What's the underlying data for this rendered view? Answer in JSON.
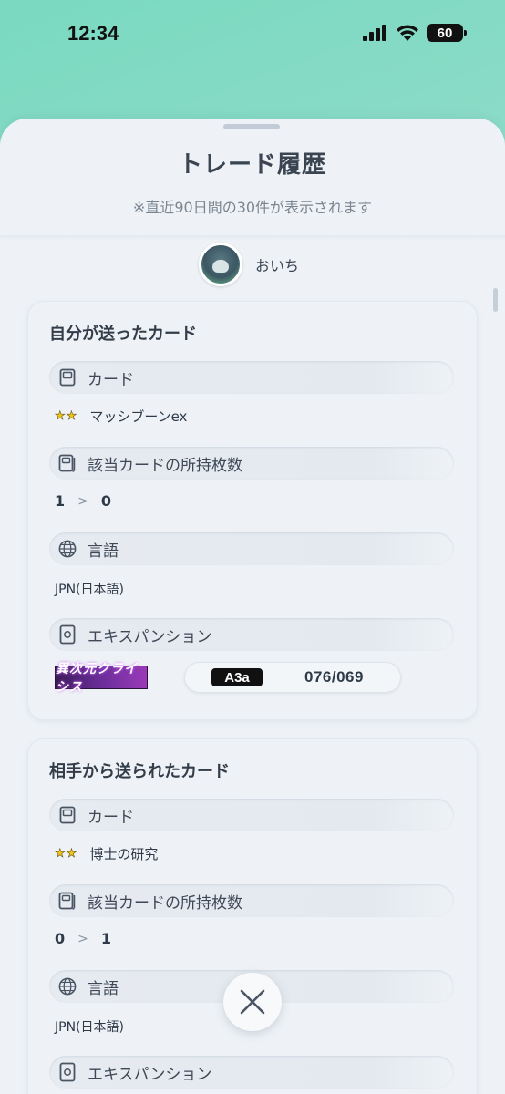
{
  "status_bar": {
    "time": "12:34",
    "battery": "60"
  },
  "sheet": {
    "title": "トレード履歴",
    "subtitle": "※直近90日間の30件が表示されます"
  },
  "user": {
    "name": "おいち"
  },
  "sent": {
    "title": "自分が送ったカード",
    "card_label": "カード",
    "card_name": "マッシブーンex",
    "card_rarity_stars": 2,
    "owned_label": "該当カードの所持枚数",
    "owned_from": "1",
    "owned_to": "0",
    "owned_arrow": ">",
    "language_label": "言語",
    "language_value": "JPN(日本語)",
    "expansion_label": "エキスパンション",
    "expansion_logo": "異次元クライシス",
    "expansion_code": "A3a",
    "expansion_number": "076/069"
  },
  "received": {
    "title": "相手から送られたカード",
    "card_label": "カード",
    "card_name": "博士の研究",
    "card_rarity_stars": 2,
    "owned_label": "該当カードの所持枚数",
    "owned_from": "0",
    "owned_to": "1",
    "owned_arrow": ">",
    "language_label": "言語",
    "language_value": "JPN(日本語)",
    "expansion_label": "エキスパンション"
  },
  "icons": {
    "signal": "cellular-signal-icon",
    "wifi": "wifi-icon",
    "card": "card-icon",
    "owned": "card-stack-icon",
    "language": "globe-icon",
    "expansion": "pack-icon",
    "close": "close-icon",
    "star": "star-icon"
  }
}
